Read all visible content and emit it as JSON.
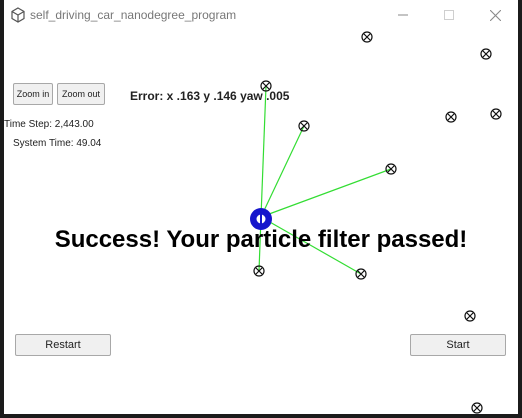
{
  "window": {
    "title": "self_driving_car_nanodegree_program"
  },
  "controls": {
    "zoom_in_label": "Zoom in",
    "zoom_out_label": "Zoom out",
    "restart_label": "Restart",
    "start_label": "Start"
  },
  "status": {
    "error": "Error: x .163 y .146 yaw .005",
    "time_step": "Time Step: 2,443.00",
    "system_time": "System Time: 49.04",
    "message": "Success! Your particle filter passed!"
  },
  "colors": {
    "observation_line": "#33dd33",
    "car_marker": "#1515cc",
    "landmark": "#000000"
  },
  "icons": {
    "app": "unity-icon",
    "landmark": "landmark-x-icon",
    "car": "car-marker-icon"
  }
}
